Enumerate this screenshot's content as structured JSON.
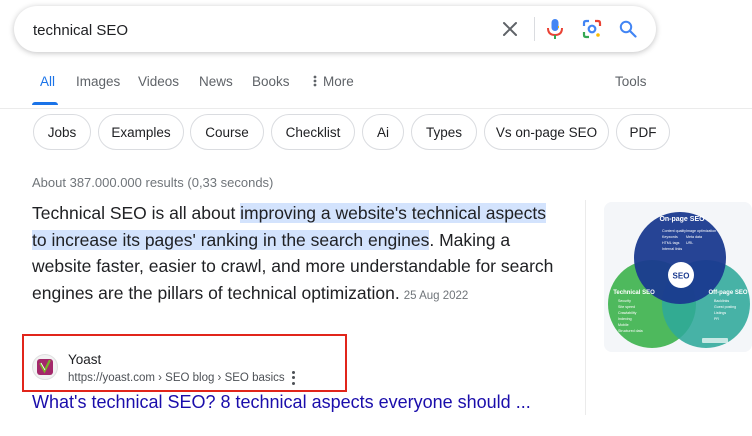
{
  "search": {
    "query": "technical SEO",
    "icons": [
      "clear-icon",
      "microphone-icon",
      "lens-icon",
      "search-icon"
    ]
  },
  "tabs": [
    {
      "label": "All",
      "active": true
    },
    {
      "label": "Images"
    },
    {
      "label": "Videos"
    },
    {
      "label": "News"
    },
    {
      "label": "Books"
    },
    {
      "label": "More"
    }
  ],
  "tools_label": "Tools",
  "chips": [
    "Jobs",
    "Examples",
    "Course",
    "Checklist",
    "Ai",
    "Types",
    "Vs on-page SEO",
    "PDF"
  ],
  "result_stats": "About 387.000.000 results (0,33 seconds)",
  "featured_snippet": {
    "text_before": "Technical SEO is all about ",
    "highlighted": "improving a website's technical aspects to increase its pages' ranking in the search engines",
    "text_after": ". Making a website faster, easier to crawl, and more understandable for search engines are the pillars of technical optimization.",
    "date": "25 Aug 2022"
  },
  "thumbnail": {
    "circles": {
      "top": {
        "label": "On-page SEO",
        "color": "#1a3a8f",
        "items": [
          "Content quality",
          "Keywords",
          "HTML tags",
          "Internal links",
          "Image optimization",
          "Meta data",
          "URL"
        ]
      },
      "left": {
        "label": "Technical SEO",
        "color": "#3fb34f",
        "items": [
          "Security",
          "Site speed",
          "Crawlability",
          "Indexing",
          "Mobile",
          "Structured data"
        ]
      },
      "right": {
        "label": "Off-page SEO",
        "color": "#2fa89a",
        "items": [
          "Backlinks",
          "Guest posting",
          "Listings",
          "PR"
        ]
      },
      "center": "SEO"
    },
    "brand_color": "#1a0dab"
  },
  "source": {
    "site_name": "Yoast",
    "url": "https://yoast.com › SEO blog › SEO basics",
    "favicon_color": "#a4286a"
  },
  "result_title": "What's technical SEO? 8 technical aspects everyone should ...",
  "highlight_box_color": "#e1251b"
}
